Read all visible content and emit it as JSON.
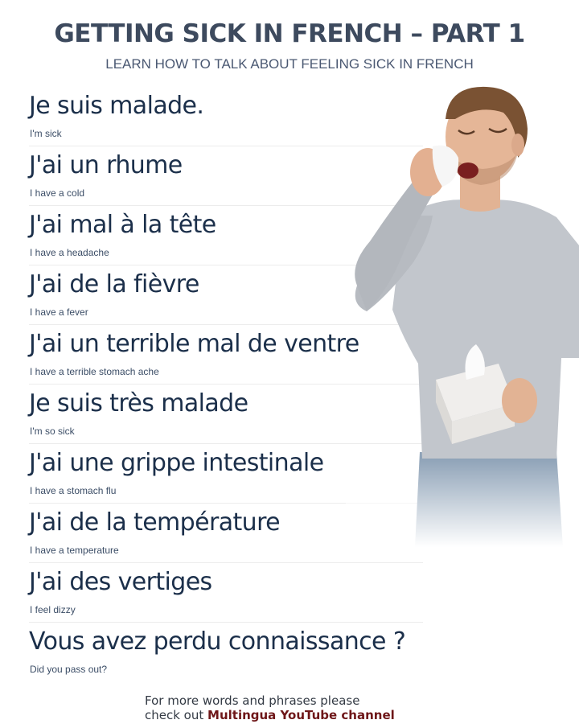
{
  "header": {
    "title": "GETTING SICK IN FRENCH – PART 1",
    "subtitle": "LEARN HOW TO TALK ABOUT FEELING SICK IN FRENCH"
  },
  "phrases": [
    {
      "fr": "Je suis malade.",
      "en": "I'm sick"
    },
    {
      "fr": "J'ai un rhume",
      "en": "I have a cold"
    },
    {
      "fr": "J'ai mal à la tête",
      "en": "I have a headache"
    },
    {
      "fr": "J'ai de la fièvre",
      "en": "I have a fever"
    },
    {
      "fr": "J'ai un terrible mal de ventre",
      "en": "I have a terrible stomach ache"
    },
    {
      "fr": "Je suis très malade",
      "en": "I'm so sick"
    },
    {
      "fr": "J'ai une grippe intestinale",
      "en": "I have a stomach flu"
    },
    {
      "fr": "J'ai de la température",
      "en": "I have a temperature"
    },
    {
      "fr": "J'ai des vertiges",
      "en": "I feel dizzy"
    },
    {
      "fr": "Vous avez perdu connaissance ?",
      "en": "Did you pass out?"
    }
  ],
  "footer": {
    "line1": "For more words and phrases please",
    "line2_prefix": "check out ",
    "link_text": "Multingua YouTube channel"
  },
  "colors": {
    "title": "#3d4a5e",
    "phrase": "#1b2f4a",
    "link": "#6e1618"
  }
}
